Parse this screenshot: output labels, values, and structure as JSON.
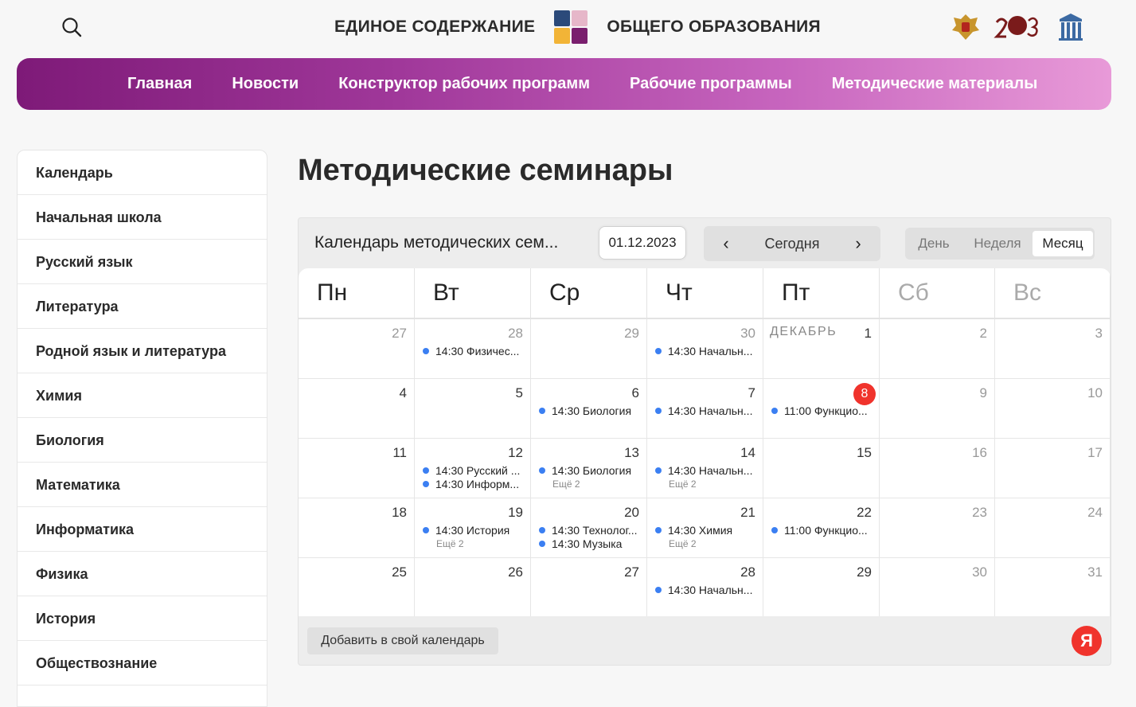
{
  "header": {
    "brand_left": "ЕДИНОЕ СОДЕРЖАНИЕ",
    "brand_right": "ОБЩЕГО ОБРАЗОВАНИЯ",
    "icons": [
      "search-icon",
      "brand-logo",
      "emblem-logo",
      "year-2023-logo",
      "institute-logo"
    ]
  },
  "nav": {
    "items": [
      "Главная",
      "Новости",
      "Конструктор рабочих программ",
      "Рабочие программы",
      "Методические материалы"
    ]
  },
  "sidebar": {
    "items": [
      "Календарь",
      "Начальная школа",
      "Русский язык",
      "Литература",
      "Родной язык и литература",
      "Химия",
      "Биология",
      "Математика",
      "Информатика",
      "Физика",
      "История",
      "Обществознание"
    ]
  },
  "page": {
    "title": "Методические семинары"
  },
  "calendar": {
    "title": "Календарь методических сем...",
    "date": "01.12.2023",
    "today_label": "Сегодня",
    "prev_icon": "chevron-left-icon",
    "next_icon": "chevron-right-icon",
    "views": [
      "День",
      "Неделя",
      "Месяц"
    ],
    "active_view": "Месяц",
    "weekdays": [
      "Пн",
      "Вт",
      "Ср",
      "Чт",
      "Пт",
      "Сб",
      "Вс"
    ],
    "month_label": "ДЕКАБРЬ",
    "weeks": [
      [
        {
          "day": "27",
          "muted": true
        },
        {
          "day": "28",
          "muted": true,
          "events": [
            "14:30 Физичес..."
          ]
        },
        {
          "day": "29",
          "muted": true
        },
        {
          "day": "30",
          "muted": true,
          "events": [
            "14:30 Начальн..."
          ]
        },
        {
          "day": "1",
          "month_label": true
        },
        {
          "day": "2",
          "muted": true
        },
        {
          "day": "3",
          "muted": true
        }
      ],
      [
        {
          "day": "4"
        },
        {
          "day": "5"
        },
        {
          "day": "6",
          "events": [
            "14:30 Биология"
          ]
        },
        {
          "day": "7",
          "events": [
            "14:30 Начальн..."
          ]
        },
        {
          "day": "8",
          "today": true,
          "events": [
            "11:00 Функцио..."
          ]
        },
        {
          "day": "9",
          "muted": true
        },
        {
          "day": "10",
          "muted": true
        }
      ],
      [
        {
          "day": "11"
        },
        {
          "day": "12",
          "events": [
            "14:30 Русский ...",
            "14:30 Информ..."
          ]
        },
        {
          "day": "13",
          "events": [
            "14:30 Биология"
          ],
          "more": "Ещё 2"
        },
        {
          "day": "14",
          "events": [
            "14:30 Начальн..."
          ],
          "more": "Ещё 2"
        },
        {
          "day": "15"
        },
        {
          "day": "16",
          "muted": true
        },
        {
          "day": "17",
          "muted": true
        }
      ],
      [
        {
          "day": "18"
        },
        {
          "day": "19",
          "events": [
            "14:30 История"
          ],
          "more": "Ещё 2"
        },
        {
          "day": "20",
          "events": [
            "14:30 Технолог...",
            "14:30 Музыка"
          ]
        },
        {
          "day": "21",
          "events": [
            "14:30 Химия"
          ],
          "more": "Ещё 2"
        },
        {
          "day": "22",
          "events": [
            "11:00 Функцио..."
          ]
        },
        {
          "day": "23",
          "muted": true
        },
        {
          "day": "24",
          "muted": true
        }
      ],
      [
        {
          "day": "25"
        },
        {
          "day": "26"
        },
        {
          "day": "27"
        },
        {
          "day": "28",
          "events": [
            "14:30 Начальн..."
          ]
        },
        {
          "day": "29"
        },
        {
          "day": "30",
          "muted": true
        },
        {
          "day": "31",
          "muted": true
        }
      ]
    ],
    "add_label": "Добавить в свой календарь",
    "provider_mark": "Я"
  },
  "colors": {
    "accent": "#8a1f83",
    "today": "#f0332c",
    "event_dot": "#3b7ff2"
  }
}
